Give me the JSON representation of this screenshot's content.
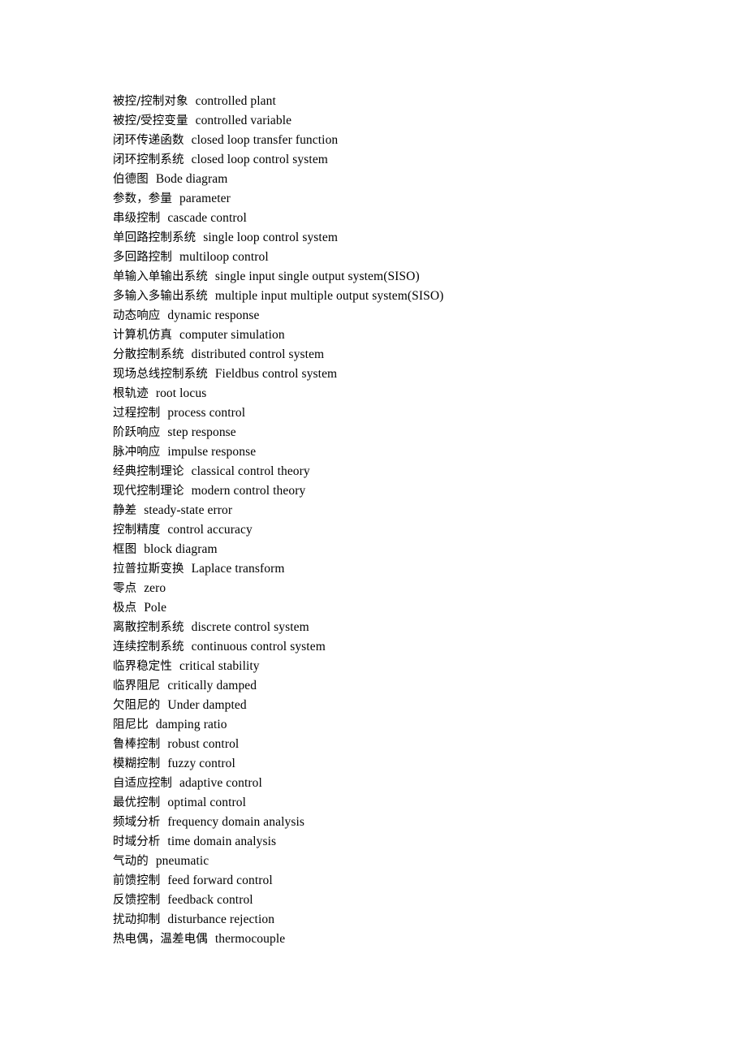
{
  "document": {
    "type": "glossary",
    "subject": "control engineering terminology",
    "entries": [
      {
        "cn": "被控/控制对象",
        "en": "controlled plant"
      },
      {
        "cn": "被控/受控变量",
        "en": "controlled variable"
      },
      {
        "cn": "闭环传递函数",
        "en": "closed loop transfer function"
      },
      {
        "cn": "闭环控制系统",
        "en": "closed loop control system"
      },
      {
        "cn": "伯德图",
        "en": "Bode diagram"
      },
      {
        "cn": "参数，参量",
        "en": "parameter"
      },
      {
        "cn": "串级控制",
        "en": "cascade control"
      },
      {
        "cn": "单回路控制系统",
        "en": "single loop control system"
      },
      {
        "cn": "多回路控制",
        "en": "multiloop control"
      },
      {
        "cn": "单输入单输出系统",
        "en": "single input single output system(SISO)"
      },
      {
        "cn": "多输入多输出系统",
        "en": "multiple input multiple output system(SISO)"
      },
      {
        "cn": "动态响应",
        "en": "dynamic response"
      },
      {
        "cn": "计算机仿真",
        "en": "computer simulation"
      },
      {
        "cn": "分散控制系统",
        "en": "distributed control system"
      },
      {
        "cn": "现场总线控制系统",
        "en": "Fieldbus control system"
      },
      {
        "cn": "根轨迹",
        "en": "root locus"
      },
      {
        "cn": "过程控制",
        "en": "process control"
      },
      {
        "cn": "阶跃响应",
        "en": "step response"
      },
      {
        "cn": "脉冲响应",
        "en": "impulse response"
      },
      {
        "cn": "经典控制理论",
        "en": "classical control theory"
      },
      {
        "cn": "现代控制理论",
        "en": "modern control theory"
      },
      {
        "cn": "静差",
        "en": "steady-state error"
      },
      {
        "cn": "控制精度",
        "en": "control accuracy"
      },
      {
        "cn": "框图",
        "en": "block diagram"
      },
      {
        "cn": "拉普拉斯变换",
        "en": "Laplace transform"
      },
      {
        "cn": "零点",
        "en": "zero"
      },
      {
        "cn": "极点",
        "en": "Pole"
      },
      {
        "cn": "离散控制系统",
        "en": "discrete control system"
      },
      {
        "cn": "连续控制系统",
        "en": "continuous control system"
      },
      {
        "cn": "临界稳定性",
        "en": "critical stability"
      },
      {
        "cn": "临界阻尼",
        "en": "critically damped"
      },
      {
        "cn": "欠阻尼的",
        "en": "Under dampted"
      },
      {
        "cn": "阻尼比",
        "en": "damping ratio"
      },
      {
        "cn": "鲁棒控制",
        "en": "robust control"
      },
      {
        "cn": "模糊控制",
        "en": "fuzzy control"
      },
      {
        "cn": "自适应控制",
        "en": "adaptive control"
      },
      {
        "cn": "最优控制",
        "en": "optimal control"
      },
      {
        "cn": "频域分析",
        "en": "frequency domain analysis"
      },
      {
        "cn": "时域分析",
        "en": "time domain analysis"
      },
      {
        "cn": "气动的",
        "en": "pneumatic"
      },
      {
        "cn": "前馈控制",
        "en": "feed forward control"
      },
      {
        "cn": "反馈控制",
        "en": "feedback control"
      },
      {
        "cn": "扰动抑制",
        "en": "disturbance rejection"
      },
      {
        "cn": "热电偶，温差电偶",
        "en": "thermocouple"
      }
    ]
  }
}
